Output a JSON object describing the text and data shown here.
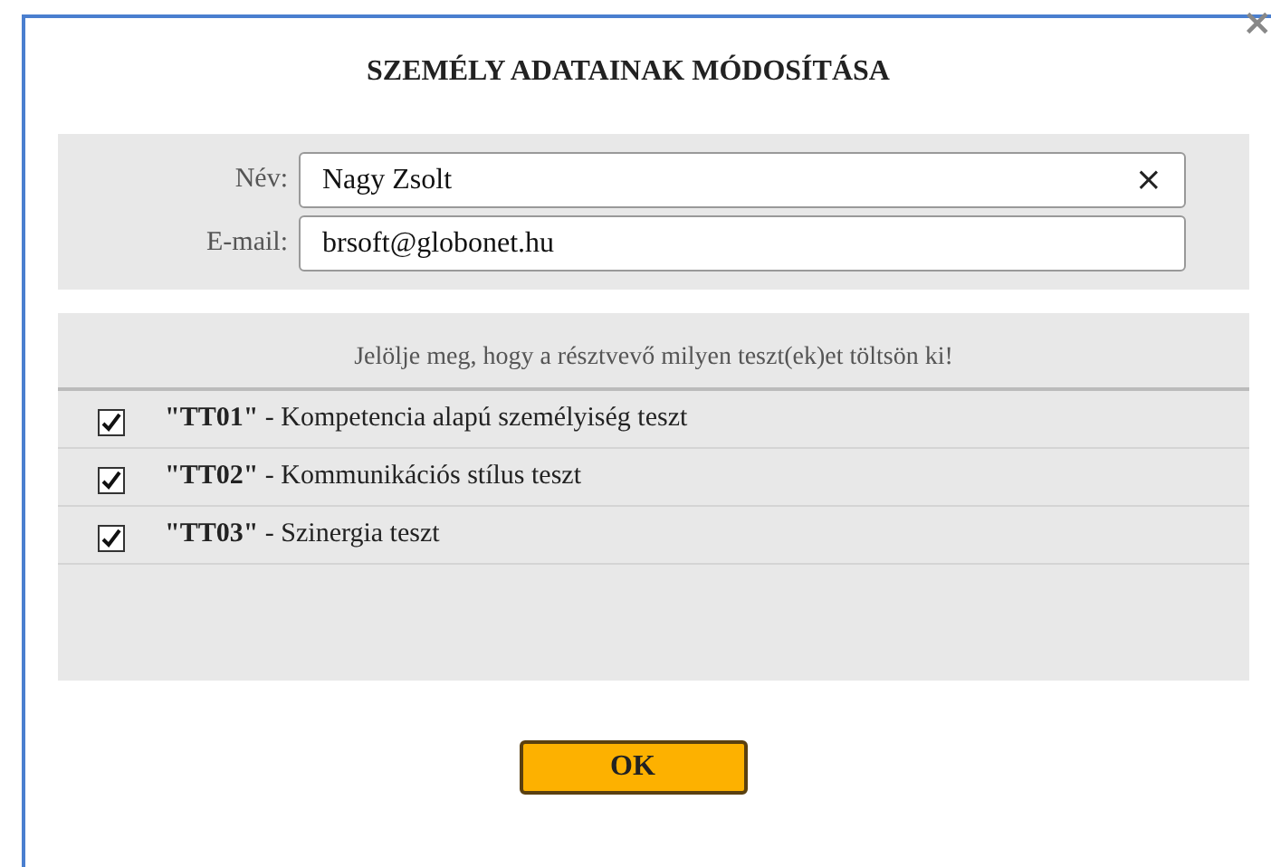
{
  "dialog": {
    "title": "SZEMÉLY ADATAINAK MÓDOSÍTÁSA",
    "close": "×"
  },
  "fields": [
    {
      "label": "Név:",
      "value": "Nagy Zsolt",
      "clear": "×"
    },
    {
      "label": "E-mail:",
      "value": "brsoft@globonet.hu"
    }
  ],
  "tests": {
    "instruction": "Jelölje meg, hogy a résztvevő milyen teszt(ek)et töltsön ki!",
    "items": [
      {
        "text": "**\"TT01\"** - Kompetencia alapú személyiség teszt",
        "checked": true
      },
      {
        "text": "**\"TT02\"** - Kommunikációs stílus teszt",
        "checked": true
      },
      {
        "text": "**\"TT03\"** - Szinergia teszt",
        "checked": true
      }
    ]
  },
  "buttons": [
    "OK"
  ]
}
